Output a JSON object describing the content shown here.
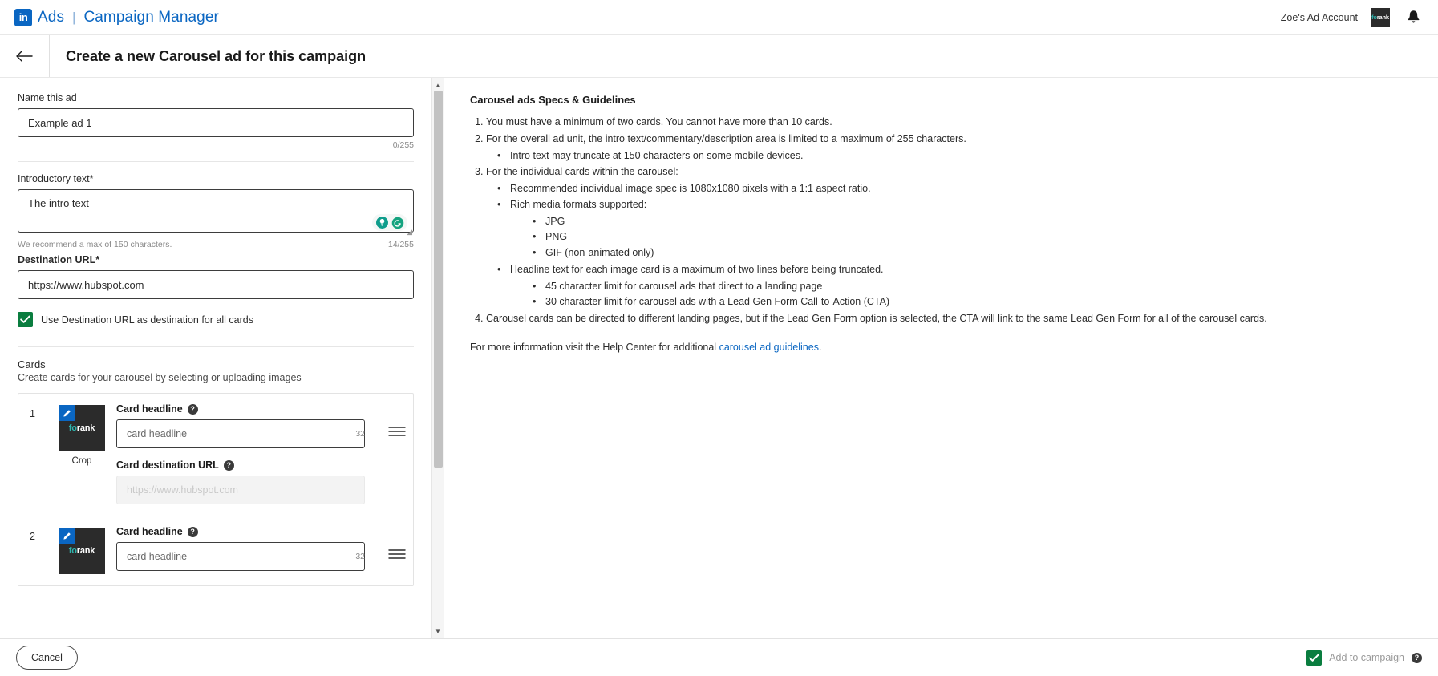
{
  "topbar": {
    "brand_ads": "Ads",
    "brand_sep": "|",
    "brand_manager": "Campaign Manager",
    "logo_text": "in",
    "account_name": "Zoe's Ad Account",
    "account_thumb_fo": "fo",
    "account_thumb_rank": "rank",
    "bell_icon": "notifications-bell-icon"
  },
  "header": {
    "back_icon": "back-arrow-icon",
    "title": "Create a new Carousel ad for this campaign"
  },
  "form": {
    "name_label": "Name this ad",
    "name_value": "Example ad 1",
    "name_counter": "0/255",
    "intro_label": "Introductory text",
    "intro_required": "*",
    "intro_value": "The intro text",
    "intro_helper": "We recommend a max of 150 characters.",
    "intro_counter": "14/255",
    "grammarly_bulb_icon": "lightbulb-icon",
    "grammarly_g_icon": "grammarly-icon",
    "dest_label": "Destination URL",
    "dest_required": "*",
    "dest_value": "https://www.hubspot.com",
    "use_dest_checkbox_label": "Use Destination URL as destination for all cards",
    "use_dest_checked": "✓"
  },
  "cards": {
    "title": "Cards",
    "subtitle": "Create cards for your carousel by selecting or uploading images",
    "headline_label": "Card headline",
    "dest_url_label": "Card destination URL",
    "headline_placeholder": "card headline",
    "headline_counter": "32",
    "dest_url_placeholder": "https://www.hubspot.com",
    "crop_label": "Crop",
    "thumb_fo": "fo",
    "thumb_rank": "rank",
    "help_glyph": "?",
    "items": [
      {
        "number": "1"
      },
      {
        "number": "2"
      }
    ]
  },
  "guidelines": {
    "title": "Carousel ads Specs & Guidelines",
    "item1": "You must have a minimum of two cards. You cannot have more than 10 cards.",
    "item2": "For the overall ad unit, the intro text/commentary/description area is limited to a maximum of 255 characters.",
    "item2_sub1": "Intro text may truncate at 150 characters on some mobile devices.",
    "item3": "For the individual cards within the carousel:",
    "item3_sub1": "Recommended individual image spec is 1080x1080 pixels with a 1:1 aspect ratio.",
    "item3_sub2": "Rich media formats supported:",
    "fmt_jpg": "JPG",
    "fmt_png": "PNG",
    "fmt_gif": "GIF (non-animated only)",
    "item3_sub3": "Headline text for each image card is a maximum of two lines before being truncated.",
    "item3_sub3a": "45 character limit for carousel ads that direct to a landing page",
    "item3_sub3b": "30 character limit for carousel ads with a Lead Gen Form Call-to-Action (CTA)",
    "item4": "Carousel cards can be directed to different landing pages, but if the Lead Gen Form option is selected, the CTA will link to the same Lead Gen Form for all of the carousel cards.",
    "more_info_prefix": "For more information visit the Help Center for additional ",
    "more_info_link": "carousel ad guidelines",
    "more_info_suffix": "."
  },
  "footer": {
    "cancel_label": "Cancel",
    "add_label": "Add to campaign",
    "add_checked": "✓",
    "help_glyph": "?"
  },
  "colors": {
    "linkedin_blue": "#0a66c2",
    "green": "#0a7d3f",
    "teal": "#2fb3ac",
    "dark_thumb": "#2b2b2b"
  }
}
